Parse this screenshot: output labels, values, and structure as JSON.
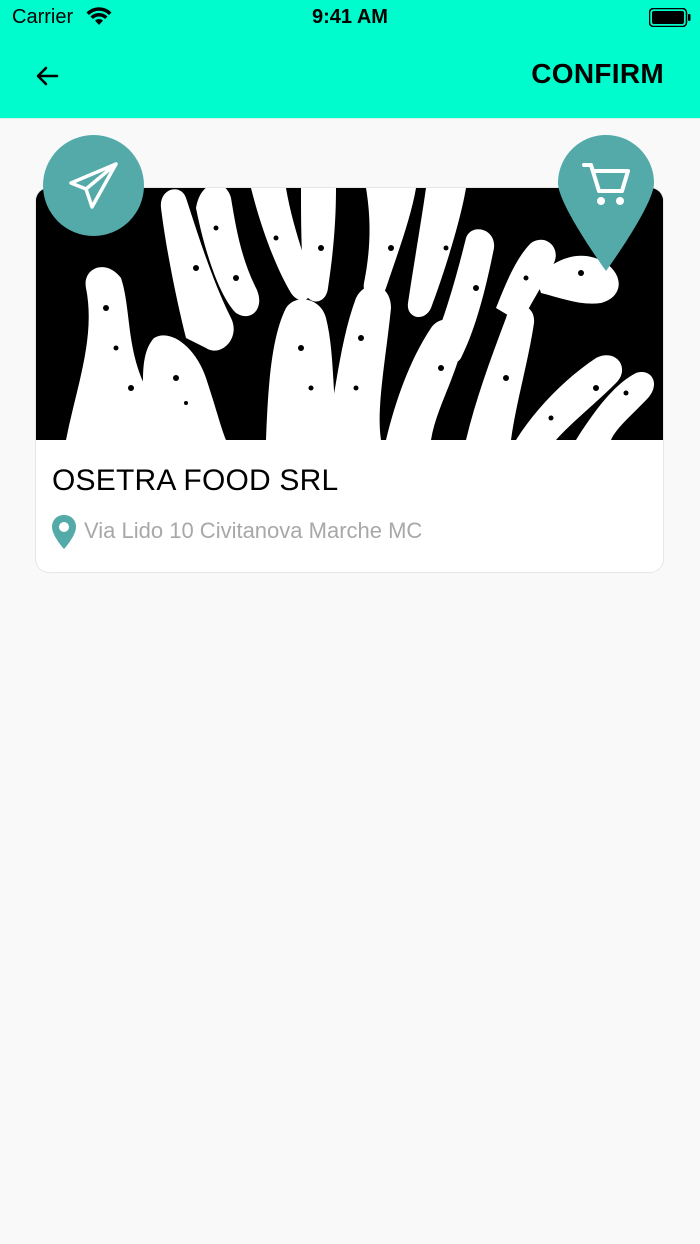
{
  "status_bar": {
    "carrier": "Carrier",
    "time": "9:41 AM"
  },
  "header": {
    "confirm_label": "CONFIRM"
  },
  "store": {
    "name": "OSETRA FOOD SRL",
    "address": "Via Lido 10 Civitanova Marche MC"
  },
  "colors": {
    "accent": "#00fccd",
    "button": "#53aaa9",
    "text": "#000000",
    "muted": "#a8a8a8"
  }
}
